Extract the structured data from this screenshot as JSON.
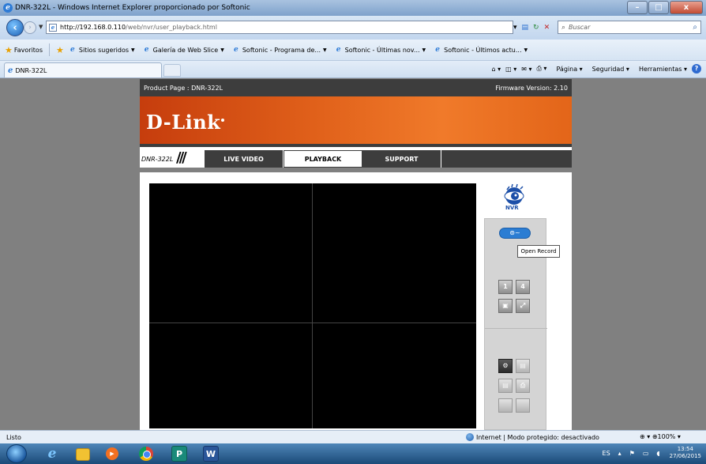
{
  "window": {
    "title": "DNR-322L - Windows Internet Explorer proporcionado por Softonic",
    "buttons": {
      "minimize": "–",
      "maximize": "□",
      "close": "x"
    }
  },
  "address": {
    "url_host": "http://192.168.0.110",
    "url_path": "/web/nvr/user_playback.html",
    "search_placeholder": "Buscar"
  },
  "favorites": {
    "label": "Favoritos",
    "items": [
      {
        "label": "Sitios sugeridos"
      },
      {
        "label": "Galería de Web Slice"
      },
      {
        "label": "Softonic - Programa de..."
      },
      {
        "label": "Softonic - Últimas nov..."
      },
      {
        "label": "Softonic - Últimos actu..."
      }
    ]
  },
  "tabs": {
    "active_label": "DNR-322L"
  },
  "command_bar": {
    "page": "Página",
    "security": "Seguridad",
    "tools": "Herramientas",
    "help": "?"
  },
  "page": {
    "product_page": "Product Page : DNR-322L",
    "firmware": "Firmware Version: 2.10",
    "logo": "D-Link",
    "model": "DNR-322L",
    "nav": [
      "LIVE VIDEO",
      "PLAYBACK",
      "SUPPORT"
    ],
    "active_nav": "PLAYBACK",
    "nvr_label": "NVR",
    "open_record_button": "⊚~",
    "tooltip": "Open Record",
    "layout_1": "1",
    "layout_4": "4"
  },
  "status": {
    "left": "Listo",
    "zone": "Internet | Modo protegido: desactivado",
    "zoom": "100%"
  },
  "taskbar": {
    "lang": "ES",
    "time": "13:54",
    "date": "27/06/2015"
  }
}
